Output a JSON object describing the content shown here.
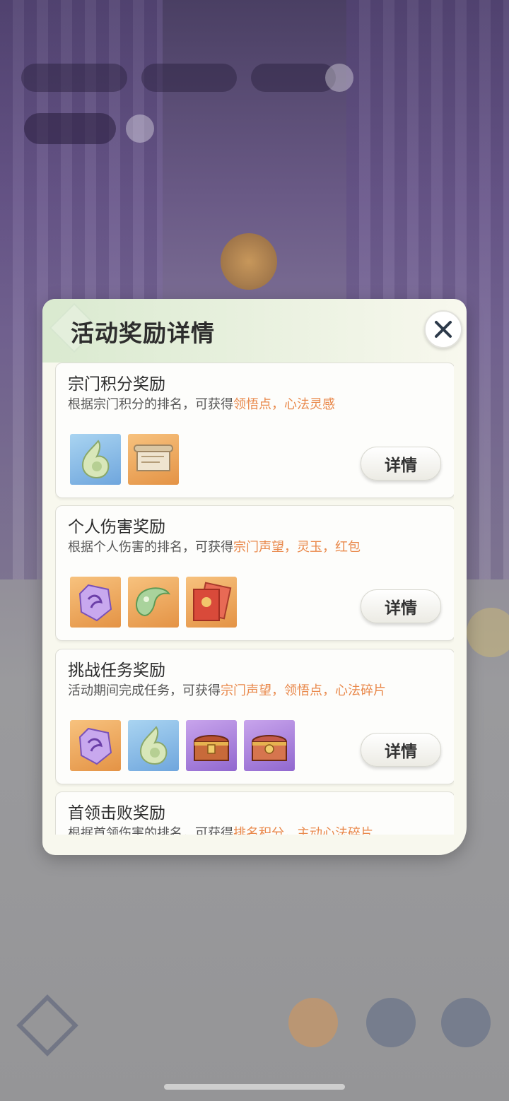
{
  "dialog": {
    "title": "活动奖励详情",
    "close_icon": "close-icon"
  },
  "cards": [
    {
      "title": "宗门积分奖励",
      "desc_prefix": "根据宗门积分的排名，可获得",
      "desc_highlight": "领悟点，心法灵感",
      "items": [
        "jade-drop-icon",
        "scroll-icon"
      ],
      "button": "详情"
    },
    {
      "title": "个人伤害奖励",
      "desc_prefix": "根据个人伤害的排名，可获得",
      "desc_highlight": "宗门声望，灵玉，红包",
      "items": [
        "purple-crystal-icon",
        "jade-icon",
        "red-envelope-icon"
      ],
      "button": "详情"
    },
    {
      "title": "挑战任务奖励",
      "desc_prefix": "活动期间完成任务，可获得",
      "desc_highlight": "宗门声望，领悟点，心法碎片",
      "items": [
        "purple-crystal-icon",
        "jade-drop-icon",
        "treasure-chest-icon",
        "treasure-chest-icon"
      ],
      "button": "详情"
    },
    {
      "title": "首领击败奖励",
      "desc_prefix": "根据首领伤害的排名，可获得",
      "desc_highlight": "排名积分，主动心法碎片",
      "items": [],
      "button": ""
    }
  ],
  "colors": {
    "highlight": "#e9884a",
    "dialog_bg": "#f8f8ee"
  }
}
